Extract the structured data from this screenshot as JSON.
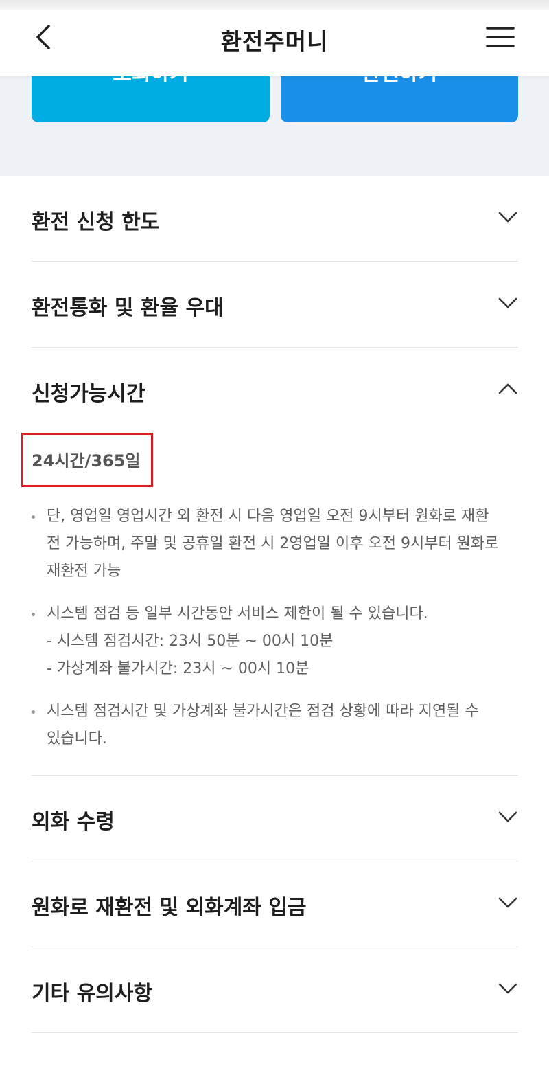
{
  "header": {
    "title": "환전주머니",
    "back_icon": "chevron-left-icon",
    "menu_icon": "hamburger-menu-icon"
  },
  "buttons": {
    "inquiry_label": "조회하기",
    "exchange_label": "환전하기"
  },
  "sections": [
    {
      "title": "환전 신청 한도",
      "expanded": false,
      "icon": "chevron-down-icon"
    },
    {
      "title": "환전통화 및 환율 우대",
      "expanded": false,
      "icon": "chevron-down-icon"
    },
    {
      "title": "신청가능시간",
      "expanded": true,
      "icon": "chevron-up-icon",
      "hours": "24시간/365일",
      "notes": [
        {
          "lines": [
            "단, 영업일 영업시간 외 환전 시 다음 영업일 오전 9시부터 원화로 재환",
            "전 가능하며, 주말 및 공휴일 환전 시 2영업일 이후 오전 9시부터 원화로",
            "재환전 가능"
          ]
        },
        {
          "lines": [
            "시스템 점검 등 일부 시간동안 서비스 제한이 될 수 있습니다.",
            "- 시스템 점검시간: 23시 50분 ~ 00시 10분",
            "- 가상계좌 불가시간: 23시 ~ 00시 10분"
          ]
        },
        {
          "lines": [
            "시스템 점검시간 및 가상계좌 불가시간은 점검 상황에 따라 지연될 수",
            "있습니다."
          ]
        }
      ]
    },
    {
      "title": "외화 수령",
      "expanded": false,
      "icon": "chevron-down-icon"
    },
    {
      "title": "원화로 재환전 및 외화계좌 입금",
      "expanded": false,
      "icon": "chevron-down-icon"
    },
    {
      "title": "기타 유의사항",
      "expanded": false,
      "icon": "chevron-down-icon"
    }
  ],
  "colors": {
    "inquiry_button": "#00ade2",
    "exchange_button": "#1a8fe8",
    "highlight_border": "#dd1e24"
  }
}
